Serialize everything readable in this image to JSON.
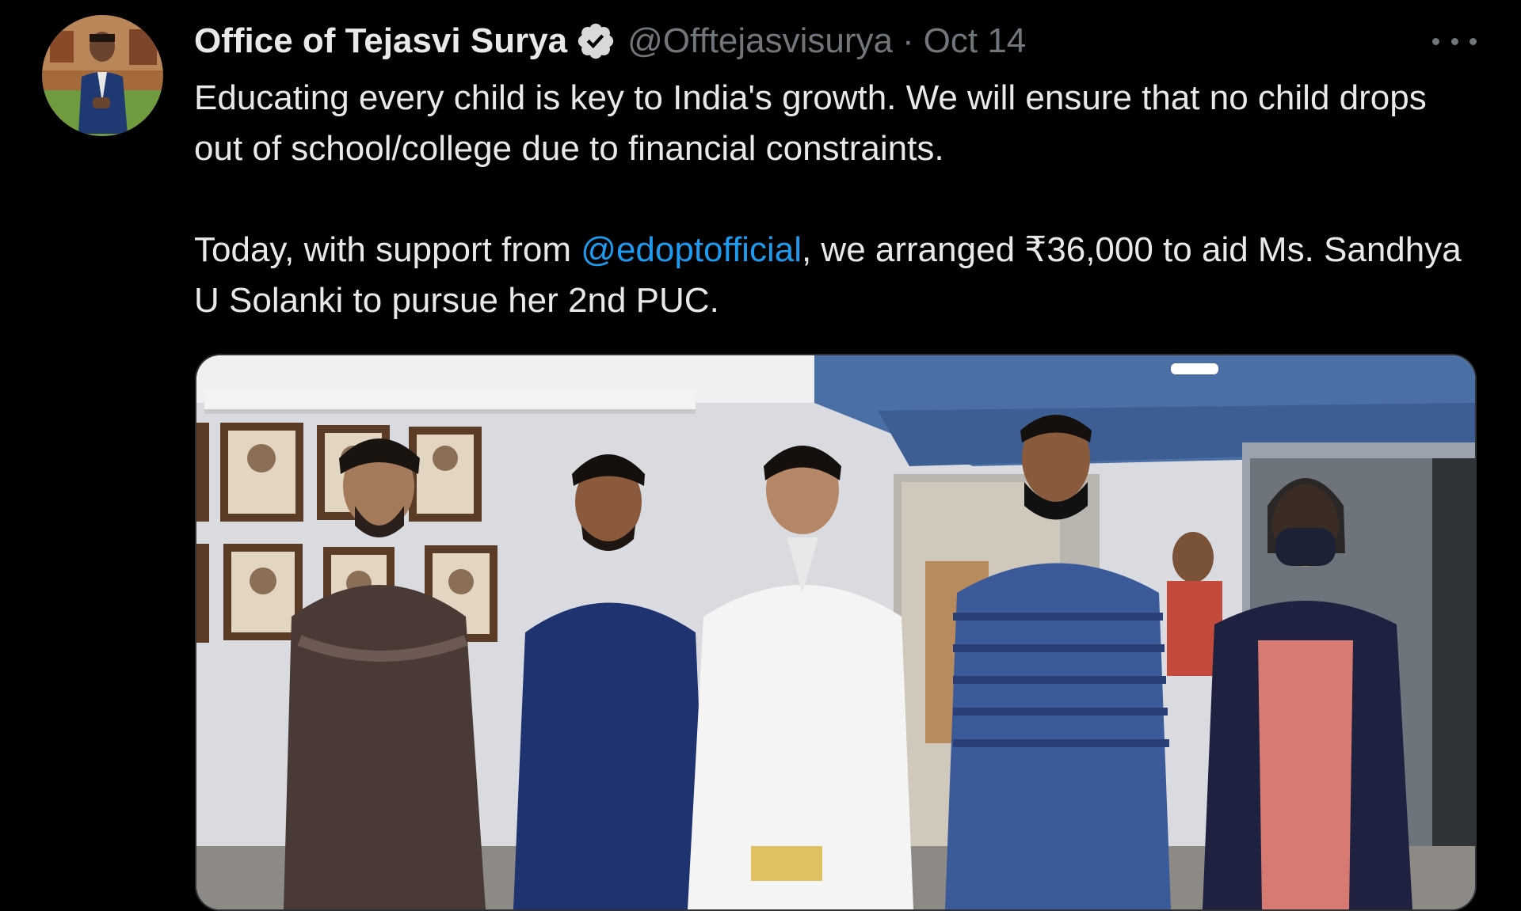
{
  "tweet": {
    "author": {
      "display_name": "Office of Tejasvi Surya",
      "handle": "@Offtejasvisurya",
      "verified_icon": "verified-badge-icon"
    },
    "separator": "·",
    "date": "Oct 14",
    "more_icon": "more-horizontal-icon",
    "text": {
      "line1": "Educating every child is key to India's growth. We will ensure that no child drops out of school/college due to financial constraints.",
      "line2_before": "Today, with support from ",
      "mention": "@edoptofficial",
      "line2_after": ", we arranged ₹36,000 to aid Ms. Sandhya U Solanki to pursue her 2nd PUC."
    }
  },
  "colors": {
    "background": "#000000",
    "text": "#e7e9ea",
    "secondary": "#71767b",
    "link": "#1d9bf0",
    "verified": "#d9d9d9"
  }
}
